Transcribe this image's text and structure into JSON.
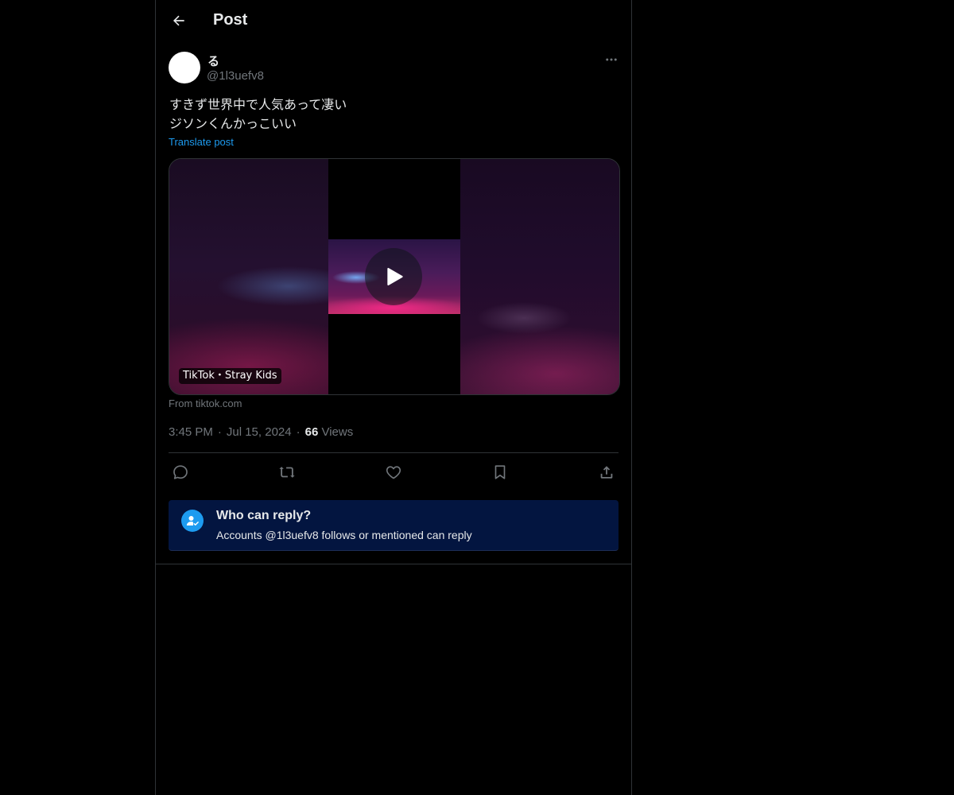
{
  "header": {
    "title": "Post",
    "back_icon": "arrow-left-icon"
  },
  "author": {
    "display_name": "る",
    "handle": "@1l3uefv8",
    "more_icon": "more-horizontal-icon"
  },
  "post": {
    "text_lines": [
      "すきず世界中で人気あって凄い",
      "ジソンくんかっこいい"
    ],
    "translate_label": "Translate post"
  },
  "media": {
    "badge": "TikTok・Stray Kids",
    "source": "From tiktok.com",
    "play_icon": "play-icon"
  },
  "meta": {
    "time": "3:45 PM",
    "date": "Jul 15, 2024",
    "views_count": "66",
    "views_label": "Views"
  },
  "actions": {
    "reply_icon": "reply-icon",
    "repost_icon": "repost-icon",
    "like_icon": "heart-icon",
    "bookmark_icon": "bookmark-icon",
    "share_icon": "share-icon"
  },
  "reply_settings": {
    "title": "Who can reply?",
    "description": "Accounts @1l3uefv8 follows or mentioned can reply",
    "icon": "user-check-icon"
  },
  "colors": {
    "background": "#000000",
    "text": "#e7e9ea",
    "secondary_text": "#71767b",
    "accent": "#1d9bf0",
    "border": "#2f3336",
    "reply_box_bg": "#031540"
  }
}
